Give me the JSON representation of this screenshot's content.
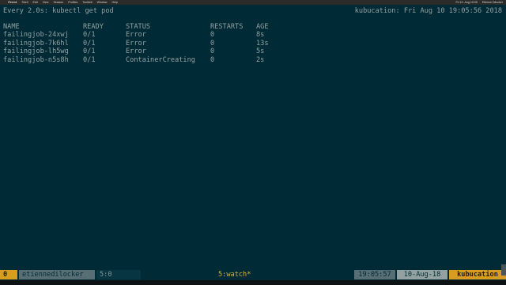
{
  "menubar": {
    "apple_glyph": "",
    "app_name": "iTerm2",
    "menus": [
      "Shell",
      "Edit",
      "View",
      "Session",
      "Profiles",
      "Toolbelt",
      "Window",
      "Help"
    ],
    "clock": "Fri 10. Aug 19:05",
    "user": "Etienne Dilocker"
  },
  "terminal": {
    "watch_header": "Every 2.0s: kubectl get pod",
    "watch_clock": "kubucation: Fri Aug 10 19:05:56 2018",
    "columns": {
      "name": "NAME",
      "ready": "READY",
      "status": "STATUS",
      "restarts": "RESTARTS",
      "age": "AGE"
    },
    "rows": [
      {
        "name": "failingjob-24xwj",
        "ready": "0/1",
        "status": "Error",
        "restarts": "0",
        "age": "8s"
      },
      {
        "name": "failingjob-7k6hl",
        "ready": "0/1",
        "status": "Error",
        "restarts": "0",
        "age": "13s"
      },
      {
        "name": "failingjob-lh5wg",
        "ready": "0/1",
        "status": "Error",
        "restarts": "0",
        "age": "5s"
      },
      {
        "name": "failingjob-n5s8h",
        "ready": "0/1",
        "status": "ContainerCreating",
        "restarts": "0",
        "age": "2s"
      }
    ]
  },
  "statusbar": {
    "session": "0",
    "user": "etiennedilocker",
    "window_prev": "5:0",
    "window_current": "5:watch*",
    "time": "19:05:57",
    "date": "10-Aug-18",
    "host": "kubucation"
  },
  "colors": {
    "terminal_bg": "#002b36",
    "terminal_fg": "#93a1a1",
    "accent": "#d79d21"
  }
}
